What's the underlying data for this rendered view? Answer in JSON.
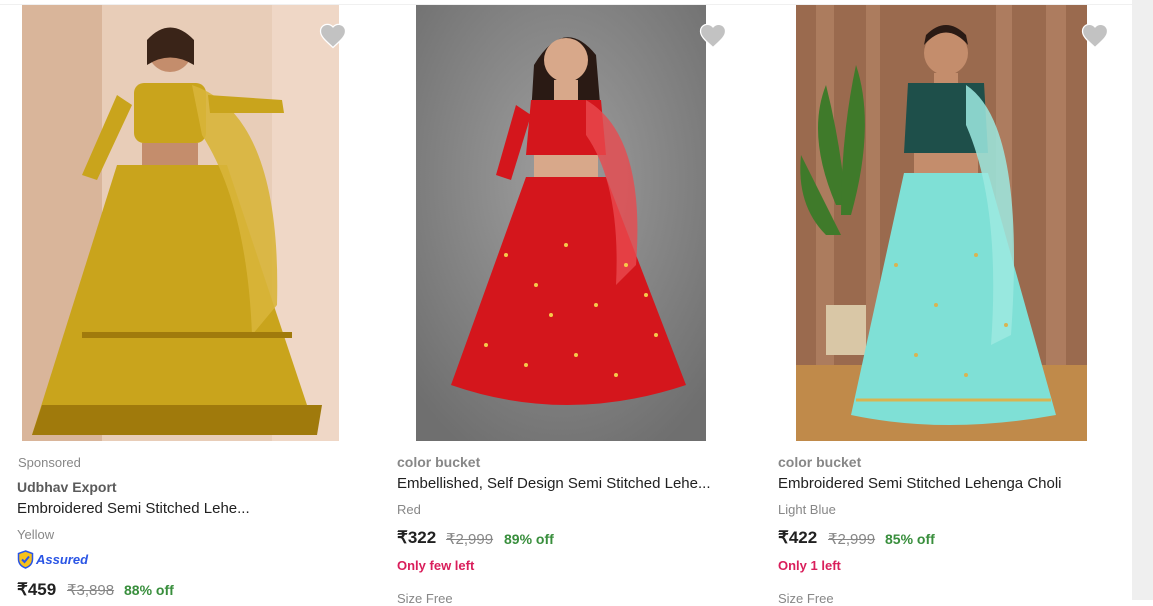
{
  "products": [
    {
      "sponsored": "Sponsored",
      "brand": "Udbhav Export",
      "title": "Embroidered Semi Stitched Lehe...",
      "color": "Yellow",
      "assured_label": "Assured",
      "price": "₹459",
      "mrp": "₹3,898",
      "discount": "88% off",
      "image_colors": {
        "bg": "#e6c9b3",
        "dress": "#c9a41c",
        "accent": "#a07a0c"
      }
    },
    {
      "brand": "color bucket",
      "title": "Embellished, Self Design Semi Stitched Lehe...",
      "color": "Red",
      "price": "₹322",
      "mrp": "₹2,999",
      "discount": "89% off",
      "stock": "Only few left",
      "size": "Size Free",
      "image_colors": {
        "bg": "#8a8a8a",
        "dress": "#d4161c",
        "accent": "#f7c94a"
      }
    },
    {
      "brand": "color bucket",
      "title": "Embroidered Semi Stitched Lehenga Choli",
      "color": "Light Blue",
      "price": "₹422",
      "mrp": "₹2,999",
      "discount": "85% off",
      "stock": "Only 1 left",
      "size": "Size Free",
      "image_colors": {
        "bg": "#a87758",
        "dress": "#7fe0d6",
        "accent": "#1e4f4a"
      }
    }
  ],
  "icons": {
    "wishlist": "heart-icon",
    "assured": "assured-shield-icon"
  },
  "colors": {
    "price": "#212121",
    "discount": "#388e3c",
    "stock": "#d91e5b",
    "assured": "#2a55e5"
  }
}
